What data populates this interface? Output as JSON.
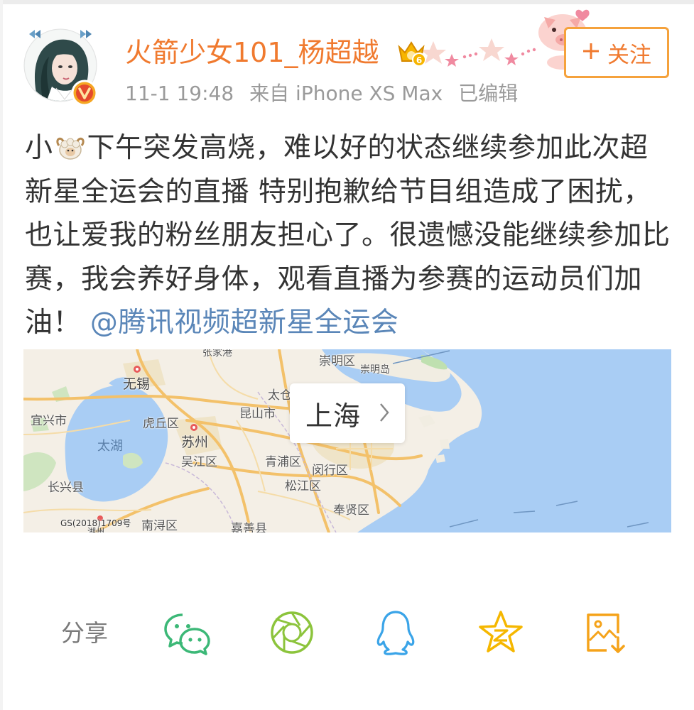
{
  "header": {
    "username": "火箭少女101_杨超越",
    "time": "11-1 19:48",
    "source": "来自 iPhone XS Max",
    "edited": "已编辑",
    "follow_label": "关注",
    "follow_icon": "plus-icon",
    "accent_color": "#f07a2f"
  },
  "post": {
    "text_before": "小",
    "emoji_name": "ram-emoji",
    "text_after": "下午突发高烧，难以好的状态继续参加此次超新星全运会的直播 特别抱歉给节目组造成了困扰，也让爱我的粉丝朋友担心了。很遗憾没能继续参加比赛，我会养好身体，观看直播为参赛的运动员们加油！",
    "mention": "@腾讯视频超新星全运会",
    "mention_color": "#5a86b8"
  },
  "map": {
    "location": "上海",
    "labels": {
      "wuxi": "无锡",
      "taihu": "太湖",
      "yixing": "宜兴市",
      "huqiu": "虎丘区",
      "suzhou": "苏州",
      "wujiang": "吴江区",
      "kunshan": "昆山市",
      "taicang": "太仓",
      "qingpu": "青浦区",
      "minhang": "闵行区",
      "songjiang": "松江区",
      "fengxian": "奉贤区",
      "changxing": "长兴县",
      "nanxun": "南浔区",
      "jiashan": "嘉善县",
      "chongming": "崇明区",
      "chongmingdao": "崇明岛",
      "zhangjiagang": "张家港",
      "copyright": "GS(2018)1709号",
      "huzhou": "湖州"
    }
  },
  "share": {
    "label": "分享",
    "icons": [
      "wechat-icon",
      "moments-icon",
      "qq-icon",
      "qzone-icon",
      "save-image-icon"
    ]
  }
}
